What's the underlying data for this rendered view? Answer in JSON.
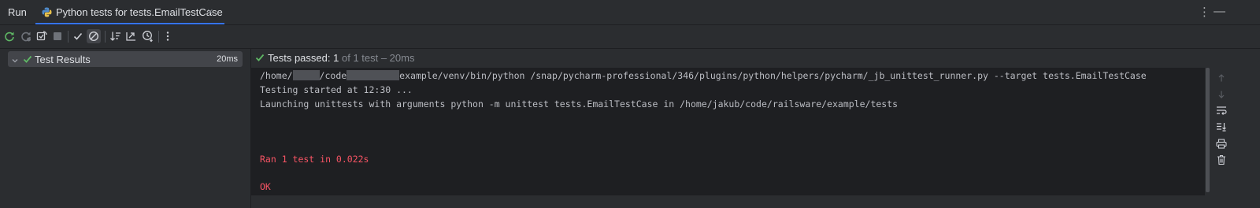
{
  "header": {
    "run_label": "Run",
    "tab_label": "Python tests for tests.EmailTestCase",
    "tab_close": "×",
    "more_icon": "⋮",
    "minimize_icon": "—"
  },
  "toolbar": {
    "items": [
      {
        "icon": "rerun-icon"
      },
      {
        "icon": "rerun-failed-icon"
      },
      {
        "icon": "toggle-auto-test-icon"
      },
      {
        "icon": "stop-icon"
      },
      {
        "icon": "show-passed-icon"
      },
      {
        "icon": "show-ignored-icon"
      },
      {
        "icon": "sort-alphabetically-icon"
      },
      {
        "icon": "sort-by-duration-icon"
      },
      {
        "icon": "test-history-icon"
      },
      {
        "icon": "more-options-icon"
      }
    ]
  },
  "tree": {
    "root_label": "Test Results",
    "root_duration": "20ms"
  },
  "status": {
    "prefix": "Tests passed:",
    "count": "1",
    "suffix": "of 1 test – 20ms"
  },
  "console": {
    "cmd_part1": "/home/",
    "cmd_part2": "/code",
    "cmd_part3": "example/venv/bin/python /snap/pycharm-professional/346/plugins/python/helpers/pycharm/_jb_unittest_runner.py --target tests.EmailTestCase",
    "line2": "Testing started at 12:30 ...",
    "line3": "Launching unittests with arguments python -m unittest tests.EmailTestCase in /home/jakub/code/railsware/example/tests",
    "line4": "Ran 1 test in 0.022s",
    "line5": "OK"
  },
  "colors": {
    "accent": "#3574f0",
    "success": "#5fb865",
    "error": "#f75464",
    "console_bg": "#1e1f22",
    "panel_bg": "#2b2d30"
  }
}
